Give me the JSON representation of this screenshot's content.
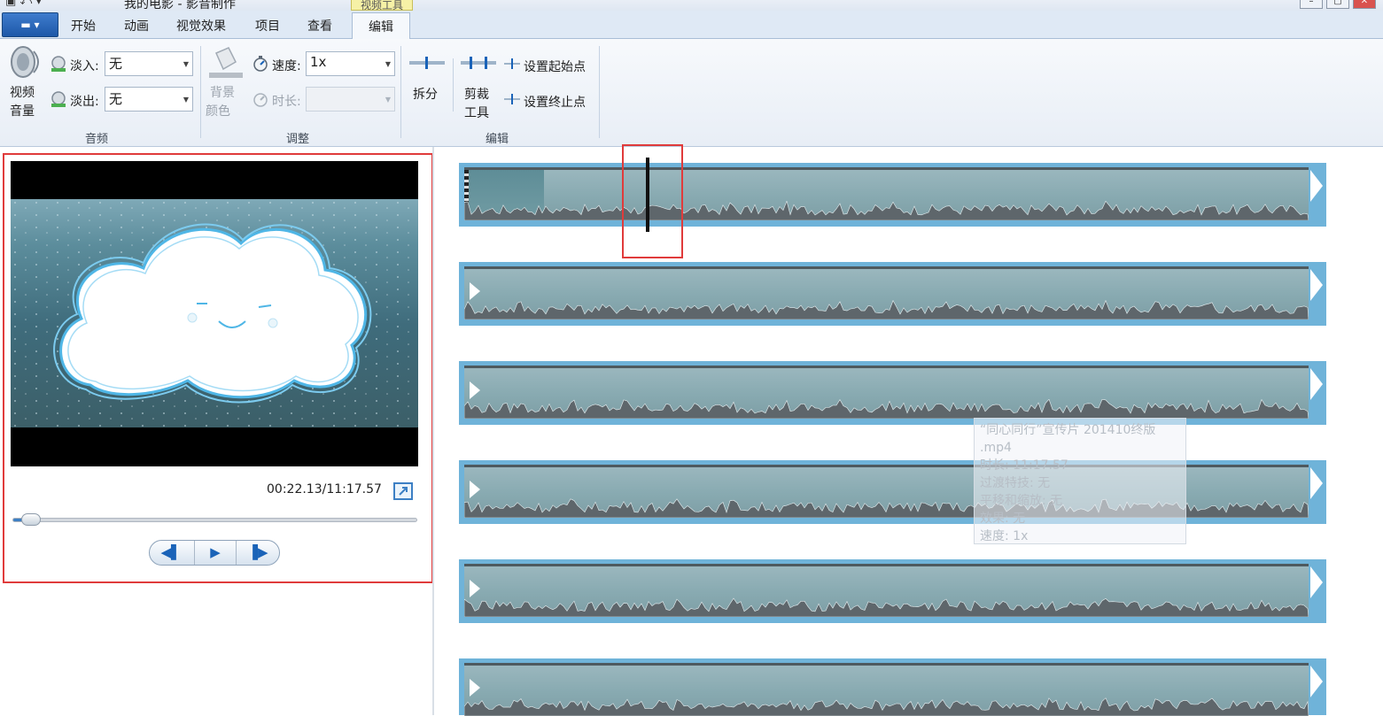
{
  "window": {
    "title": "我的电影 - 影音制作",
    "context_tab": "视频工具",
    "quick_access": "▾"
  },
  "tabs": {
    "app_menu": "▬ ▾",
    "items": [
      "开始",
      "动画",
      "视觉效果",
      "项目",
      "查看",
      "编辑"
    ],
    "active": "编辑"
  },
  "ribbon": {
    "audio": {
      "group_label": "音频",
      "volume_label_1": "视频",
      "volume_label_2": "音量",
      "fade_in_label": "淡入:",
      "fade_in_value": "无",
      "fade_out_label": "淡出:",
      "fade_out_value": "无"
    },
    "adjust": {
      "group_label": "调整",
      "bg_color_label_1": "背景",
      "bg_color_label_2": "颜色",
      "speed_label": "速度:",
      "speed_value": "1x",
      "duration_label": "时长:",
      "duration_value": ""
    },
    "edit": {
      "group_label": "编辑",
      "split_label": "拆分",
      "trim_label_1": "剪裁",
      "trim_label_2": "工具",
      "set_start": "设置起始点",
      "set_end": "设置终止点"
    }
  },
  "preview": {
    "timecode": "00:22.13/11:17.57",
    "progress": 0.033,
    "controls": [
      "prev-frame",
      "play",
      "next-frame"
    ]
  },
  "timeline": {
    "tracks": 6
  },
  "tooltip": {
    "lines": [
      "“同心同行”宣传片 201410终版",
      ".mp4",
      "时长: 11:17.57",
      "过渡特技: 无",
      "平移和缩放: 无",
      "效果: 无",
      "速度: 1x"
    ]
  },
  "colors": {
    "accent": "#3c7fc4",
    "track_border": "#6fb3d9",
    "highlight": "#e03b3b"
  }
}
